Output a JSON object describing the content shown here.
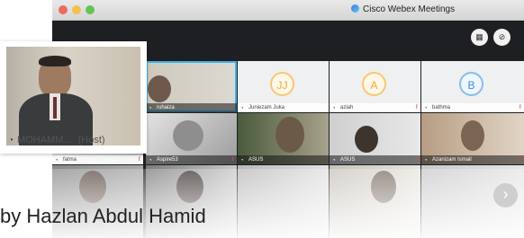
{
  "window": {
    "title": "Cisco Webex Meetings"
  },
  "toolbar": {
    "layout_icon": "grid-layout-icon",
    "pin_icon": "pin-icon"
  },
  "host": {
    "name": "MOHAMM...",
    "role": "(Host)"
  },
  "participants": [
    {
      "name": "ruhaiza",
      "initials": "",
      "kind": "video"
    },
    {
      "name": "Juniezam Juka",
      "initials": "JJ",
      "kind": "avatar"
    },
    {
      "name": "aziah",
      "initials": "A",
      "kind": "avatar"
    },
    {
      "name": "bathma",
      "initials": "B",
      "kind": "avatar"
    },
    {
      "name": "fatma",
      "initials": "",
      "kind": "video"
    },
    {
      "name": "Aspire53",
      "initials": "",
      "kind": "video"
    },
    {
      "name": "ASUS",
      "initials": "",
      "kind": "video"
    },
    {
      "name": "ASUS",
      "initials": "",
      "kind": "video"
    },
    {
      "name": "Azanizam Ismail",
      "initials": "",
      "kind": "video"
    }
  ],
  "nav": {
    "next_icon": "chevron-right-icon",
    "next_glyph": "›"
  },
  "caption": "by Hazlan Abdul Hamid",
  "colors": {
    "active_border": "#3fb2e6",
    "mic_muted": "#e34848",
    "avatar_yellow": "#f7c873",
    "avatar_blue": "#8bbcea"
  }
}
